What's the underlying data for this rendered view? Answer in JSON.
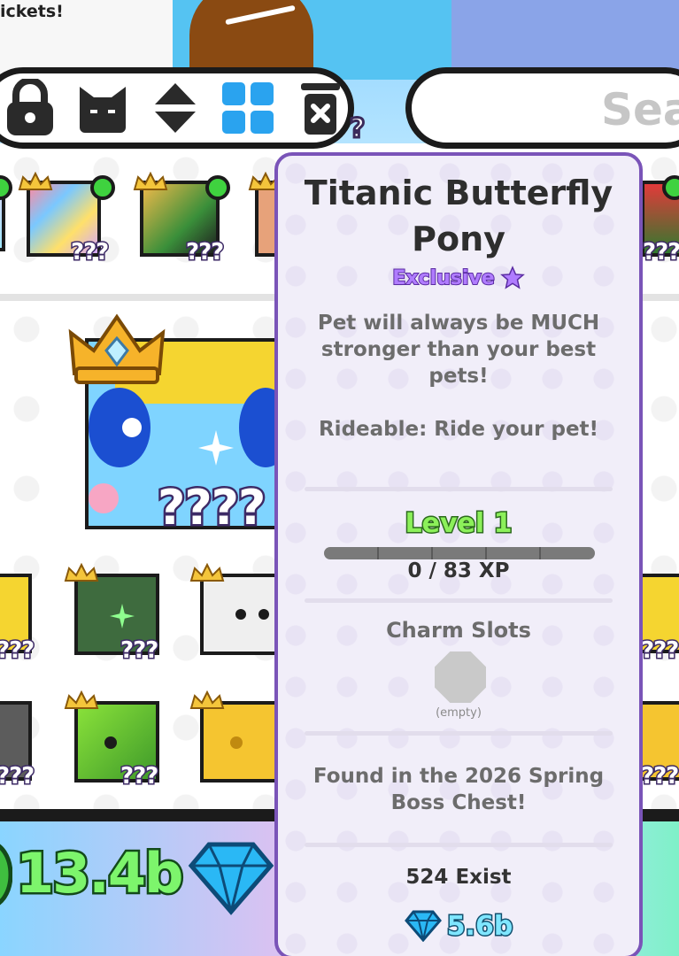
{
  "header": {
    "tickets_text": "ickets!"
  },
  "toolbar": {
    "buttons": [
      {
        "name": "lock"
      },
      {
        "name": "cat-face"
      },
      {
        "name": "sort"
      },
      {
        "name": "grid"
      },
      {
        "name": "delete"
      }
    ]
  },
  "search": {
    "placeholder": "Sea"
  },
  "inventory": {
    "unknown_label": "???",
    "unknown_label_big": "????",
    "peek_label": "?"
  },
  "currency": {
    "coins": "13.4b"
  },
  "tooltip": {
    "title": "Titanic Butterfly Pony",
    "rarity": "Exclusive",
    "description": "Pet will always be MUCH stronger than your best pets!",
    "ability": "Rideable: Ride your pet!",
    "level_label": "Level 1",
    "xp_fraction": 0.0,
    "xp_text": "0 / 83 XP",
    "charm_title": "Charm Slots",
    "charm_empty": "(empty)",
    "found_in": "Found in the 2026 Spring Boss Chest!",
    "exist_count": "524 Exist",
    "price": "5.6b"
  },
  "colors": {
    "rarity_purple": "#b07cff",
    "level_green": "#8cf05a",
    "diamond_blue": "#7fe6ff",
    "card_border": "#7a54b8"
  }
}
